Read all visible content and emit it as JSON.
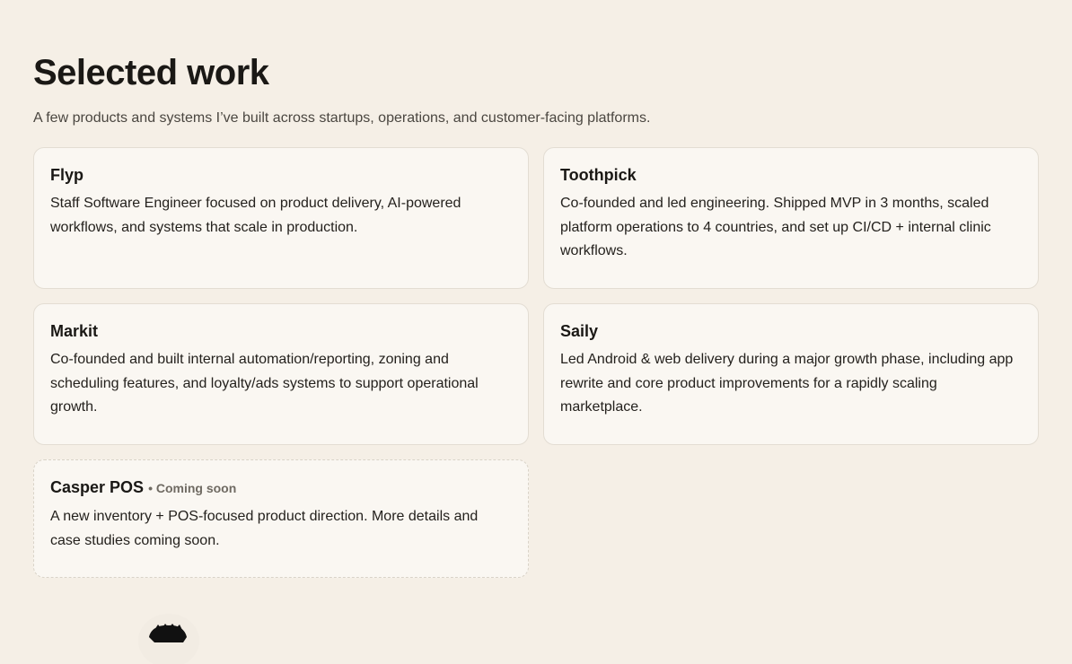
{
  "header": {
    "title": "Selected work",
    "subtitle": "A few products and systems I’ve built across startups, operations, and customer-facing platforms."
  },
  "projects": [
    {
      "name": "Flyp",
      "badge": "",
      "description": "Staff Software Engineer focused on product delivery, AI-powered workflows, and systems that scale in production."
    },
    {
      "name": "Toothpick",
      "badge": "",
      "description": "Co-founded and led engineering. Shipped MVP in 3 months, scaled platform operations to 4 countries, and set up CI/CD + internal clinic workflows."
    },
    {
      "name": "Markit",
      "badge": "",
      "description": "Co-founded and built internal automation/reporting, zoning and scheduling features, and loyalty/ads systems to support operational growth."
    },
    {
      "name": "Saily",
      "badge": "",
      "description": "Led Android & web delivery during a major growth phase, including app rewrite and core product improvements for a rapidly scaling marketplace."
    },
    {
      "name": "Casper POS",
      "badge": "• Coming soon",
      "description": "A new inventory + POS-focused product direction. More details and case studies coming soon."
    }
  ],
  "colors": {
    "background": "#f5efe6",
    "card": "#faf7f2",
    "card_border": "#e3ddd3",
    "text": "#1a1815",
    "muted": "#6f6a62"
  },
  "avatar": {
    "icon": "avatar-illustration"
  }
}
